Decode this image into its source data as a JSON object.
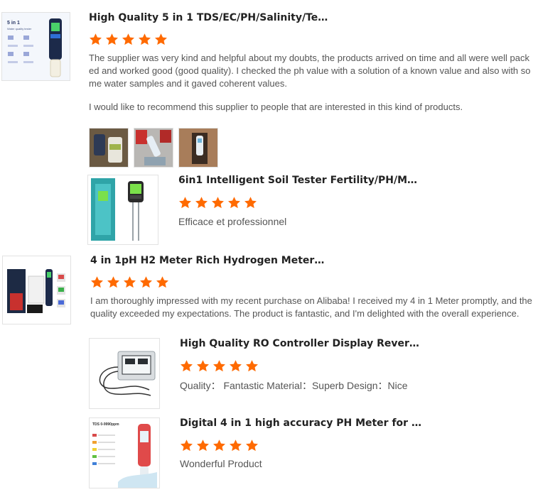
{
  "reviews": [
    {
      "title": "High Quality 5 in 1 TDS/EC/PH/Salinity/Temper...",
      "rating": 5,
      "comment_p1": "The supplier was very kind and helpful about my doubts, the products arrived on time and all were well packed and worked good (good quality). I checked the ph value with a solution of a known value and also with some water samples and it gaved coherent values.",
      "comment_p2": "I would like to recommend this supplier to people that are interested in this kind of products.",
      "thumb_lines": [
        "5 in 1",
        "Water quality tester"
      ]
    },
    {
      "title": "6in1 Intelligent Soil Tester Fertility/PH/Moistur...",
      "rating": 5,
      "comment": "Efficace et professionnel"
    },
    {
      "title": "4 in 1pH H2 Meter Rich Hydrogen Meter Digital...",
      "rating": 5,
      "comment": "I am thoroughly impressed with my recent purchase on Alibaba! I received my 4 in 1 Meter promptly, and the quality exceeded my expectations. The product is fantastic, and I'm delighted with the overall experience."
    },
    {
      "title": "High Quality RO Controller Display Reverse Os...",
      "rating": 5,
      "comment": "Quality： Fantastic Material：Superb  Design：Nice"
    },
    {
      "title": "Digital 4 in 1 high accuracy PH Meter for Hous...",
      "rating": 5,
      "comment": "Wonderful Product",
      "thumb_lines": [
        "TDS 0-9990ppm"
      ]
    }
  ],
  "colors": {
    "star": "#ff6a00",
    "title": "#222222",
    "text": "#555555"
  }
}
